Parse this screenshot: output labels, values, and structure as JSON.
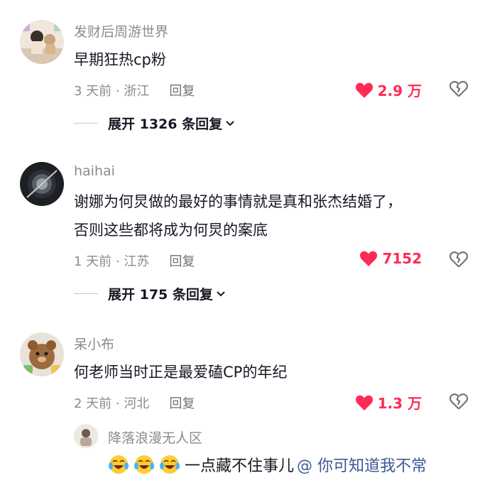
{
  "comments": [
    {
      "username": "发财后周游世界",
      "text": "早期狂热cp粉",
      "time_location": "3 天前 · 浙江",
      "reply": "回复",
      "likes": "2.9 万",
      "expand": "展开 1326 条回复"
    },
    {
      "username": "haihai",
      "text_line1": "谢娜为何炅做的最好的事情就是真和张杰结婚了，",
      "text_line2": "否则这些都将成为何炅的案底",
      "time_location": "1 天前 · 江苏",
      "reply": "回复",
      "likes": "7152",
      "expand": "展开 175 条回复"
    },
    {
      "username": "呆小布",
      "text": "何老师当时正是最爱磕CP的年纪",
      "time_location": "2 天前 · 河北",
      "reply": "回复",
      "likes": "1.3 万"
    }
  ],
  "subreply": {
    "username": "降落浪漫无人区",
    "text": "一点藏不住事儿",
    "mention": "@ 你可知道我不常"
  },
  "colors": {
    "like": "#fe2c55",
    "meta": "#8a8b91",
    "mention": "#3b5998"
  },
  "icons": {
    "like": "heart-icon",
    "dislike": "broken-heart-icon",
    "expand": "chevron-down-icon",
    "emoji": "laughing-tears-emoji"
  }
}
